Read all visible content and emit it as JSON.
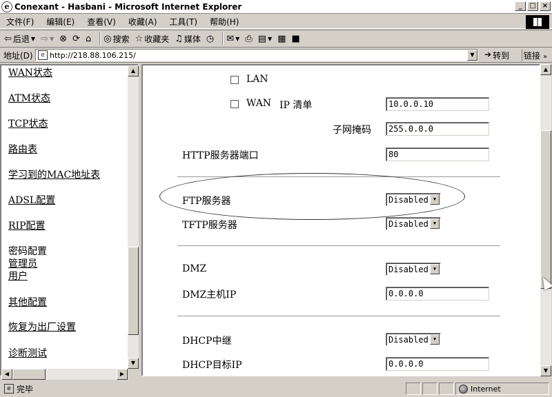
{
  "window": {
    "title": "Conexant - Hasbani - Microsoft Internet Explorer",
    "icon": "ie-icon",
    "buttons": [
      "minimize",
      "maximize",
      "close"
    ]
  },
  "menu": [
    "文件(F)",
    "编辑(E)",
    "查看(V)",
    "收藏(A)",
    "工具(T)",
    "帮助(H)"
  ],
  "toolbar": {
    "back": "后退",
    "forward": "",
    "search": "搜索",
    "favorites": "收藏夹",
    "media": "媒体"
  },
  "address": {
    "label": "地址(D)",
    "url": "http://218.88.106.215/",
    "go": "转到",
    "links": "链接"
  },
  "left_nav": [
    {
      "label": "WAN状态",
      "link": true
    },
    {
      "label": "ATM状态",
      "link": true
    },
    {
      "label": "TCP状态",
      "link": true
    },
    {
      "label": "路由表",
      "link": true
    },
    {
      "label": "学习到的MAC地址表",
      "link": true
    },
    {
      "label": "ADSL配置",
      "link": true
    },
    {
      "label": "RIP配置",
      "link": true
    },
    {
      "label": "密码配置",
      "link": false
    },
    {
      "label": "管理员",
      "link": true
    },
    {
      "label": "用户",
      "link": true
    },
    {
      "label": "其他配置",
      "link": true
    },
    {
      "label": "恢复为出厂设置",
      "link": true
    },
    {
      "label": "诊断测试",
      "link": true
    }
  ],
  "form": {
    "lan_label": "LAN",
    "wan_label": "WAN",
    "ip_list_label": "IP 清单",
    "wan_ip_value": "10.0.0.10",
    "subnet_label": "子网掩码",
    "subnet_value": "255.0.0.0",
    "http_port_label": "HTTP服务器端口",
    "http_port_value": "80",
    "ftp_label": "FTP服务器",
    "ftp_value": "Disabled",
    "tftp_label": "TFTP服务器",
    "tftp_value": "Disabled",
    "dmz_label": "DMZ",
    "dmz_value": "Disabled",
    "dmz_ip_label": "DMZ主机IP",
    "dmz_ip_value": "0.0.0.0",
    "dhcp_relay_label": "DHCP中继",
    "dhcp_relay_value": "Disabled",
    "dhcp_target_label": "DHCP目标IP",
    "dhcp_target_value": "0.0.0.0"
  },
  "status": {
    "text": "完毕",
    "zone": "Internet"
  }
}
